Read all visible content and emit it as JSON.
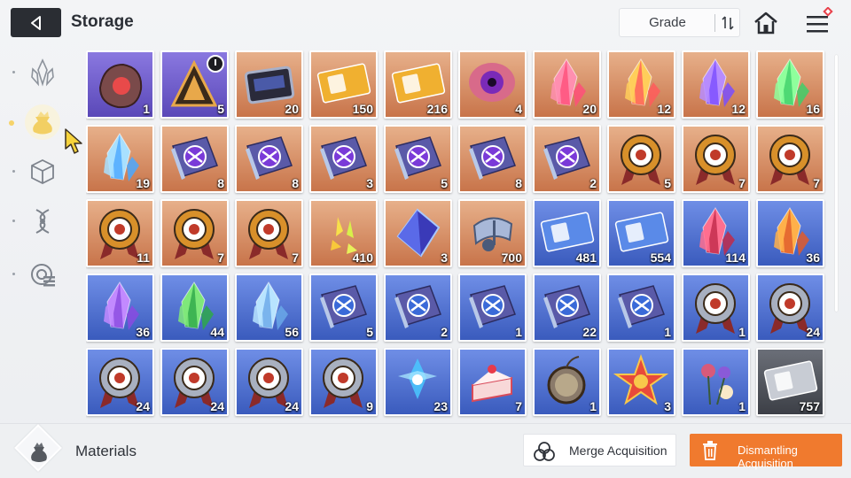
{
  "header": {
    "title": "Storage",
    "sort_label": "Grade"
  },
  "sidebar": {
    "items": [
      {
        "icon": "crystal-category-icon",
        "selected": false
      },
      {
        "icon": "pouch-category-icon",
        "selected": true
      },
      {
        "icon": "cube-category-icon",
        "selected": false
      },
      {
        "icon": "helix-category-icon",
        "selected": false
      },
      {
        "icon": "chip-category-icon",
        "selected": false
      }
    ]
  },
  "grid": {
    "items": [
      {
        "name": "dark-ore-item",
        "rarity": "purple",
        "qty": "1"
      },
      {
        "name": "pyramid-token-item",
        "rarity": "purple",
        "qty": "5",
        "timed": true
      },
      {
        "name": "data-chip-item",
        "rarity": "orange",
        "qty": "20"
      },
      {
        "name": "gold-ticket-item",
        "rarity": "orange",
        "qty": "150"
      },
      {
        "name": "gold-compass-ticket-item",
        "rarity": "orange",
        "qty": "216"
      },
      {
        "name": "eye-core-item",
        "rarity": "orange",
        "qty": "4"
      },
      {
        "name": "pink-crystal-item",
        "rarity": "orange",
        "qty": "20"
      },
      {
        "name": "rainbow-crystal-item",
        "rarity": "orange",
        "qty": "12"
      },
      {
        "name": "violet-crystal-item",
        "rarity": "orange",
        "qty": "12"
      },
      {
        "name": "green-crystal-item",
        "rarity": "orange",
        "qty": "16"
      },
      {
        "name": "blue-crystal-item",
        "rarity": "orange",
        "qty": "19"
      },
      {
        "name": "skill-book-sword-item",
        "rarity": "orange",
        "qty": "8"
      },
      {
        "name": "skill-book-shield-item",
        "rarity": "orange",
        "qty": "8"
      },
      {
        "name": "skill-book-eye-item",
        "rarity": "orange",
        "qty": "3"
      },
      {
        "name": "skill-book-wings-item",
        "rarity": "orange",
        "qty": "5"
      },
      {
        "name": "skill-book-blade-item",
        "rarity": "orange",
        "qty": "8"
      },
      {
        "name": "skill-book-target-item",
        "rarity": "orange",
        "qty": "2"
      },
      {
        "name": "gold-medal-sword-item",
        "rarity": "orange",
        "qty": "5"
      },
      {
        "name": "gold-medal-shield-item",
        "rarity": "orange",
        "qty": "7"
      },
      {
        "name": "gold-medal-eye-item",
        "rarity": "orange",
        "qty": "7"
      },
      {
        "name": "gold-medal-blade-item",
        "rarity": "orange",
        "qty": "11"
      },
      {
        "name": "gold-medal-spark-item",
        "rarity": "orange",
        "qty": "7"
      },
      {
        "name": "gold-medal-target-item",
        "rarity": "orange",
        "qty": "7"
      },
      {
        "name": "yellow-shards-item",
        "rarity": "orange",
        "qty": "410"
      },
      {
        "name": "blue-cube-item",
        "rarity": "orange",
        "qty": "3"
      },
      {
        "name": "music-note-item",
        "rarity": "orange",
        "qty": "700"
      },
      {
        "name": "blue-ticket-item",
        "rarity": "blue",
        "qty": "481"
      },
      {
        "name": "blue-compass-ticket-item",
        "rarity": "blue",
        "qty": "554"
      },
      {
        "name": "red-crystal-item",
        "rarity": "blue",
        "qty": "114"
      },
      {
        "name": "amber-crystal-item",
        "rarity": "blue",
        "qty": "36"
      },
      {
        "name": "purple-crystal-item",
        "rarity": "blue",
        "qty": "36"
      },
      {
        "name": "emerald-crystal-item",
        "rarity": "blue",
        "qty": "44"
      },
      {
        "name": "sky-crystal-item",
        "rarity": "blue",
        "qty": "56"
      },
      {
        "name": "blue-book-sword-item",
        "rarity": "blue",
        "qty": "5"
      },
      {
        "name": "blue-book-eye-item",
        "rarity": "blue",
        "qty": "2"
      },
      {
        "name": "blue-book-wings-item",
        "rarity": "blue",
        "qty": "1"
      },
      {
        "name": "blue-book-blade-item",
        "rarity": "blue",
        "qty": "22"
      },
      {
        "name": "blue-book-target-item",
        "rarity": "blue",
        "qty": "1"
      },
      {
        "name": "silver-medal-sword-item",
        "rarity": "blue",
        "qty": "1"
      },
      {
        "name": "silver-medal-shield-item",
        "rarity": "blue",
        "qty": "24"
      },
      {
        "name": "silver-medal-eye-item",
        "rarity": "blue",
        "qty": "24"
      },
      {
        "name": "silver-medal-cross-item",
        "rarity": "blue",
        "qty": "24"
      },
      {
        "name": "silver-medal-bolt-item",
        "rarity": "blue",
        "qty": "24"
      },
      {
        "name": "silver-medal-target-item",
        "rarity": "blue",
        "qty": "9"
      },
      {
        "name": "ice-flower-item",
        "rarity": "blue",
        "qty": "23"
      },
      {
        "name": "strawberry-cake-item",
        "rarity": "blue",
        "qty": "7"
      },
      {
        "name": "pocket-watch-item",
        "rarity": "blue",
        "qty": "1"
      },
      {
        "name": "star-emblem-item",
        "rarity": "blue",
        "qty": "3"
      },
      {
        "name": "flower-bouquet-item",
        "rarity": "blue",
        "qty": "1"
      },
      {
        "name": "silver-ticket-item",
        "rarity": "silver",
        "qty": "757"
      }
    ]
  },
  "footer": {
    "category_label": "Materials",
    "merge_label": "Merge Acquisition",
    "dismantle_label": "Dismantling Acquisition"
  },
  "colors": {
    "accent_orange": "#f07a2e",
    "rarity_purple": "#6e5cc8",
    "rarity_orange": "#d9895a",
    "rarity_blue": "#4a6ad0",
    "rarity_silver": "#4a4d55"
  }
}
